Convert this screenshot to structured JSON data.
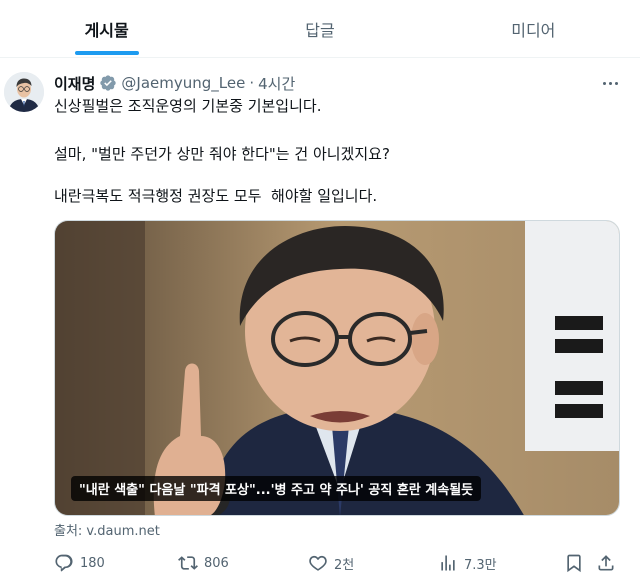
{
  "tabs": [
    {
      "label": "게시물",
      "active": true
    },
    {
      "label": "답글",
      "active": false
    },
    {
      "label": "미디어",
      "active": false
    }
  ],
  "tweet": {
    "author_name": "이재명",
    "handle": "@Jaemyung_Lee",
    "separator": "·",
    "time": "4시간",
    "lines": [
      "신상필벌은 조직운영의 기본중 기본입니다.",
      "설마, \"벌만 주던가 상만 줘야 한다\"는 건 아니겠지요?",
      "내란극복도 적극행정 권장도 모두  해야할 일입니다."
    ],
    "media_caption": "\"내란 색출\" 다음날 \"파격 포상\"...'병 주고 약 주나' 공직 혼란 계속될듯",
    "source": "출처: v.daum.net"
  },
  "actions": {
    "reply_count": "180",
    "retweet_count": "806",
    "like_count": "2천",
    "view_count": "7.3만"
  },
  "colors": {
    "accent": "#1d9bf0",
    "muted_text": "#536471",
    "primary_text": "#0f1419"
  },
  "icons": [
    "verified-badge-icon",
    "more-icon",
    "reply-icon",
    "retweet-icon",
    "like-icon",
    "views-icon",
    "bookmark-icon",
    "share-icon"
  ]
}
